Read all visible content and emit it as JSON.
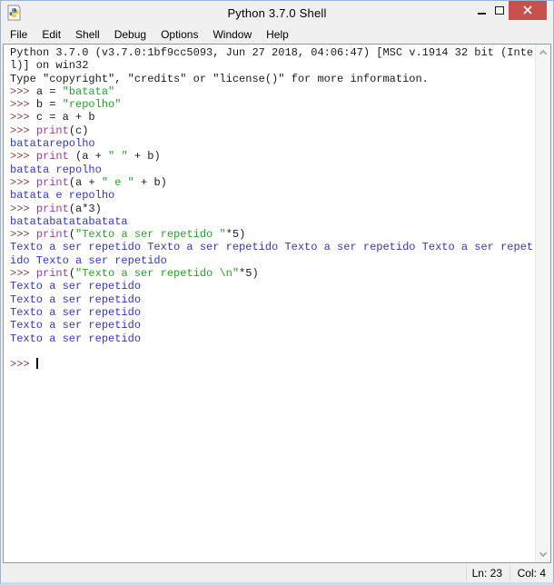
{
  "window": {
    "title": "Python 3.7.0 Shell",
    "icons": {
      "app": "python-idle-icon",
      "minimize": "minimize-dash",
      "maximize": "maximize-square",
      "close": "close-x",
      "scroll_up": "chevron-up",
      "scroll_down": "chevron-down"
    }
  },
  "menu": {
    "items": [
      {
        "label": "File"
      },
      {
        "label": "Edit"
      },
      {
        "label": "Shell"
      },
      {
        "label": "Debug"
      },
      {
        "label": "Options"
      },
      {
        "label": "Window"
      },
      {
        "label": "Help"
      }
    ]
  },
  "shell": {
    "lines": [
      [
        {
          "c": "n",
          "t": "Python 3.7.0 (v3.7.0:1bf9cc5093, Jun 27 2018, 04:06:47) [MSC v.1914 32 bit (Inte"
        }
      ],
      [
        {
          "c": "n",
          "t": "l)] on win32"
        }
      ],
      [
        {
          "c": "n",
          "t": "Type \"copyright\", \"credits\" or \"license()\" for more information."
        }
      ],
      [
        {
          "c": "p",
          "t": ">>> "
        },
        {
          "c": "n",
          "t": "a = "
        },
        {
          "c": "s",
          "t": "\"batata\""
        }
      ],
      [
        {
          "c": "p",
          "t": ">>> "
        },
        {
          "c": "n",
          "t": "b = "
        },
        {
          "c": "s",
          "t": "\"repolho\""
        }
      ],
      [
        {
          "c": "p",
          "t": ">>> "
        },
        {
          "c": "n",
          "t": "c = a + b"
        }
      ],
      [
        {
          "c": "p",
          "t": ">>> "
        },
        {
          "c": "b",
          "t": "print"
        },
        {
          "c": "n",
          "t": "(c)"
        }
      ],
      [
        {
          "c": "o",
          "t": "batatarepolho"
        }
      ],
      [
        {
          "c": "p",
          "t": ">>> "
        },
        {
          "c": "b",
          "t": "print"
        },
        {
          "c": "n",
          "t": " (a + "
        },
        {
          "c": "s",
          "t": "\" \""
        },
        {
          "c": "n",
          "t": " + b)"
        }
      ],
      [
        {
          "c": "o",
          "t": "batata repolho"
        }
      ],
      [
        {
          "c": "p",
          "t": ">>> "
        },
        {
          "c": "b",
          "t": "print"
        },
        {
          "c": "n",
          "t": "(a + "
        },
        {
          "c": "s",
          "t": "\" e \""
        },
        {
          "c": "n",
          "t": " + b)"
        }
      ],
      [
        {
          "c": "o",
          "t": "batata e repolho"
        }
      ],
      [
        {
          "c": "p",
          "t": ">>> "
        },
        {
          "c": "b",
          "t": "print"
        },
        {
          "c": "n",
          "t": "(a*3)"
        }
      ],
      [
        {
          "c": "o",
          "t": "batatabatatabatata"
        }
      ],
      [
        {
          "c": "p",
          "t": ">>> "
        },
        {
          "c": "b",
          "t": "print"
        },
        {
          "c": "n",
          "t": "("
        },
        {
          "c": "s",
          "t": "\"Texto a ser repetido \""
        },
        {
          "c": "n",
          "t": "*5)"
        }
      ],
      [
        {
          "c": "o",
          "t": "Texto a ser repetido Texto a ser repetido Texto a ser repetido Texto a ser repet"
        }
      ],
      [
        {
          "c": "o",
          "t": "ido Texto a ser repetido"
        }
      ],
      [
        {
          "c": "p",
          "t": ">>> "
        },
        {
          "c": "b",
          "t": "print"
        },
        {
          "c": "n",
          "t": "("
        },
        {
          "c": "s",
          "t": "\"Texto a ser repetido \\n\""
        },
        {
          "c": "n",
          "t": "*5)"
        }
      ],
      [
        {
          "c": "o",
          "t": "Texto a ser repetido"
        }
      ],
      [
        {
          "c": "o",
          "t": "Texto a ser repetido"
        }
      ],
      [
        {
          "c": "o",
          "t": "Texto a ser repetido"
        }
      ],
      [
        {
          "c": "o",
          "t": "Texto a ser repetido"
        }
      ],
      [
        {
          "c": "o",
          "t": "Texto a ser repetido"
        }
      ],
      [],
      [
        {
          "c": "p",
          "t": ">>> "
        },
        {
          "c": "cursor",
          "t": ""
        }
      ]
    ]
  },
  "status_bar": {
    "line_label": "Ln: 23",
    "col_label": "Col: 4"
  },
  "colors": {
    "titlebar_bg": "#f0f0f0",
    "close_button_red": "#c75050",
    "window_border": "#9cb6ce",
    "text_normal": "#1a1a1a",
    "prompt": "#8c4040",
    "string": "#25a325",
    "builtin": "#a138a1",
    "stdout": "#3434d1",
    "text_area_bg": "#ffffff"
  }
}
